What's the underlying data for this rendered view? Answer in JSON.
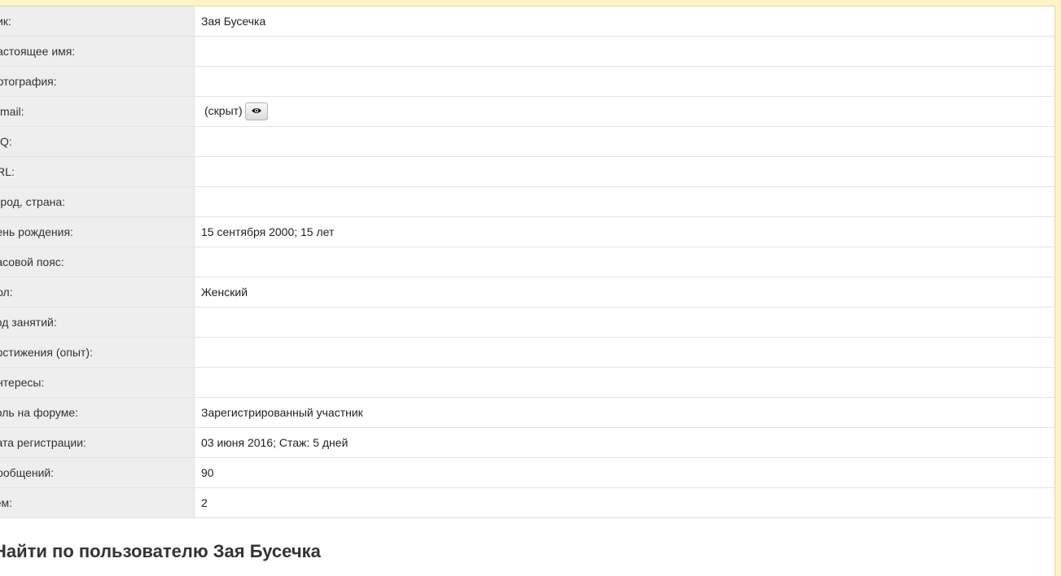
{
  "profile": {
    "rows": [
      {
        "label": "Ник:",
        "value": "Зая Бусечка"
      },
      {
        "label": "Настоящее имя:",
        "value": ""
      },
      {
        "label": "Фотография:",
        "value": ""
      },
      {
        "label": "E-mail:",
        "value": "(скрыт)"
      },
      {
        "label": "ICQ:",
        "value": ""
      },
      {
        "label": "URL:",
        "value": ""
      },
      {
        "label": "Город, страна:",
        "value": ""
      },
      {
        "label": "День рождения:",
        "value": "15 сентября 2000; 15 лет"
      },
      {
        "label": "Часовой пояс:",
        "value": ""
      },
      {
        "label": "Пол:",
        "value": "Женский"
      },
      {
        "label": "Род занятий:",
        "value": ""
      },
      {
        "label": "Достижения (опыт):",
        "value": ""
      },
      {
        "label": "Интересы:",
        "value": ""
      },
      {
        "label": "Роль на форуме:",
        "value": "Зарегистрированный участник"
      },
      {
        "label": "Дата регистрации:",
        "value": "03 июня 2016; Стаж: 5 дней"
      },
      {
        "label": "Сообщений:",
        "value": "90"
      },
      {
        "label": "Тем:",
        "value": "2"
      }
    ],
    "email_button_icon": "eye-icon"
  },
  "search": {
    "heading": "Найти по пользователю Зая Бусечка"
  }
}
